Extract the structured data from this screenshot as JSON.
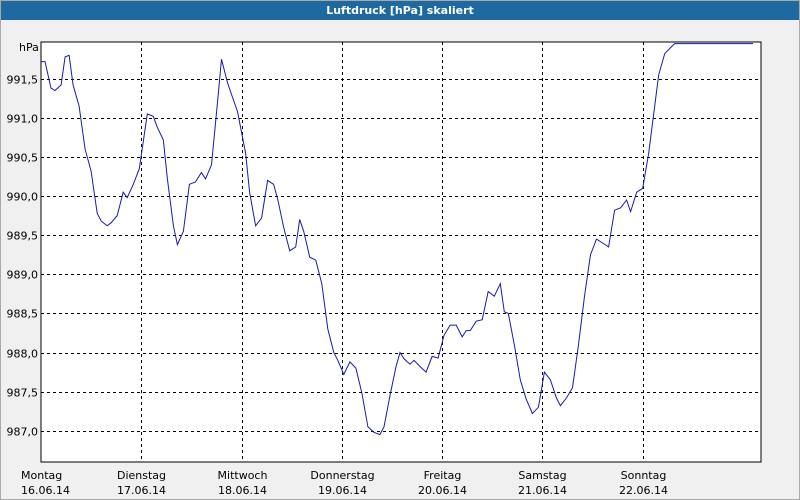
{
  "window": {
    "title": "Luftdruck [hPa] skaliert"
  },
  "colors": {
    "title_bar": "#1e6aa0",
    "line": "#1a1aa8",
    "plot_bg": "#ffffff",
    "grid": "#000000"
  },
  "chart_data": {
    "type": "line",
    "title": "Luftdruck [hPa] skaliert",
    "ylabel": "hPa",
    "xlabel": "",
    "ylim": [
      986.6,
      991.97
    ],
    "yticks": [
      "991,5",
      "991,0",
      "990,5",
      "990,0",
      "989,5",
      "989,0",
      "988,5",
      "988,0",
      "987,5",
      "987,0"
    ],
    "ytick_values": [
      991.5,
      991.0,
      990.5,
      990.0,
      989.5,
      989.0,
      988.5,
      988.0,
      987.5,
      987.0
    ],
    "xlim": [
      0,
      7.18
    ],
    "x_categories": [
      {
        "day": "Montag",
        "date": "16.06.14"
      },
      {
        "day": "Dienstag",
        "date": "17.06.14"
      },
      {
        "day": "Mittwoch",
        "date": "18.06.14"
      },
      {
        "day": "Donnerstag",
        "date": "19.06.14"
      },
      {
        "day": "Freitag",
        "date": "20.06.14"
      },
      {
        "day": "Samstag",
        "date": "21.06.14"
      },
      {
        "day": "Sonntag",
        "date": "22.06.14"
      }
    ],
    "grid": true,
    "legend": "none",
    "series": [
      {
        "x": [
          0.0,
          0.04,
          0.1,
          0.14,
          0.2,
          0.24,
          0.28,
          0.32,
          0.38,
          0.44,
          0.5,
          0.56,
          0.6,
          0.66,
          0.7,
          0.76,
          0.82,
          0.86,
          0.92,
          0.98,
          1.02,
          1.06,
          1.12,
          1.16,
          1.22,
          1.26,
          1.32,
          1.36,
          1.42,
          1.48,
          1.54,
          1.6,
          1.64,
          1.7,
          1.76,
          1.8,
          1.86,
          1.9,
          1.96,
          2.04,
          2.08,
          2.14,
          2.2,
          2.26,
          2.32,
          2.36,
          2.42,
          2.48,
          2.54,
          2.58,
          2.62,
          2.68,
          2.74,
          2.8,
          2.86,
          2.92,
          2.96,
          3.02,
          3.08,
          3.14,
          3.2,
          3.26,
          3.32,
          3.38,
          3.42,
          3.48,
          3.54,
          3.58,
          3.62,
          3.68,
          3.72,
          3.78,
          3.84,
          3.9,
          3.96,
          4.02,
          4.08,
          4.14,
          4.2,
          4.24,
          4.28,
          4.34,
          4.4,
          4.46,
          4.52,
          4.58,
          4.62,
          4.66,
          4.72,
          4.78,
          4.84,
          4.9,
          4.96,
          5.02,
          5.08,
          5.14,
          5.18,
          5.24,
          5.3,
          5.36,
          5.42,
          5.48,
          5.54,
          5.6,
          5.66,
          5.72,
          5.78,
          5.84,
          5.88,
          5.94,
          6.0,
          6.06,
          6.12,
          6.16,
          6.22,
          6.28,
          6.32,
          6.38,
          6.44,
          6.5,
          6.56,
          6.6,
          6.66,
          6.72,
          6.78,
          6.84,
          6.88,
          6.92,
          6.98,
          7.04,
          7.1,
          7.16
        ],
        "y": [
          991.72,
          991.72,
          991.38,
          991.35,
          991.42,
          991.78,
          991.8,
          991.42,
          991.15,
          990.6,
          990.32,
          989.78,
          989.68,
          989.62,
          989.66,
          989.75,
          990.05,
          989.98,
          990.15,
          990.35,
          990.7,
          991.05,
          991.02,
          990.88,
          990.72,
          990.22,
          989.62,
          989.38,
          989.55,
          990.15,
          990.18,
          990.3,
          990.22,
          990.4,
          991.2,
          991.75,
          991.45,
          991.3,
          991.08,
          990.55,
          990.05,
          989.62,
          989.72,
          990.2,
          990.15,
          989.96,
          989.6,
          989.3,
          989.35,
          989.7,
          989.55,
          989.22,
          989.18,
          988.88,
          988.3,
          988.0,
          987.9,
          987.72,
          987.88,
          987.8,
          987.48,
          987.05,
          986.98,
          986.95,
          987.05,
          987.45,
          987.82,
          988.0,
          987.92,
          987.85,
          987.9,
          987.82,
          987.75,
          987.95,
          987.93,
          988.22,
          988.35,
          988.35,
          988.2,
          988.28,
          988.28,
          988.4,
          988.42,
          988.78,
          988.72,
          988.88,
          988.52,
          988.5,
          988.1,
          987.65,
          987.4,
          987.22,
          987.3,
          987.75,
          987.65,
          987.42,
          987.32,
          987.42,
          987.55,
          988.1,
          988.72,
          989.25,
          989.45,
          989.4,
          989.35,
          989.82,
          989.85,
          989.95,
          989.8,
          990.05,
          990.1,
          990.55,
          991.15,
          991.55,
          991.82,
          991.9,
          991.95,
          991.95,
          991.95,
          991.95,
          991.95,
          991.95,
          991.95,
          991.95,
          991.95,
          991.95,
          991.95,
          991.95,
          991.95,
          991.95,
          991.95,
          991.95
        ]
      }
    ]
  }
}
